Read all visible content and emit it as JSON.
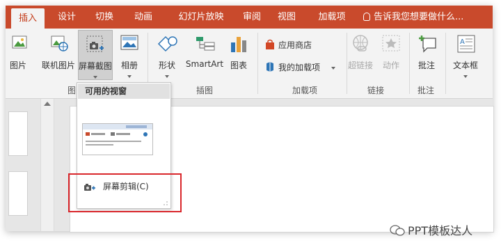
{
  "tabs": [
    {
      "label": "插入",
      "active": true
    },
    {
      "label": "设计"
    },
    {
      "label": "切换"
    },
    {
      "label": "动画"
    },
    {
      "label": "幻灯片放映"
    },
    {
      "label": "审阅"
    },
    {
      "label": "视图"
    },
    {
      "label": "加载项"
    }
  ],
  "tell_me": "告诉我您想要做什么...",
  "ribbon": {
    "pictures": "图片",
    "online_pictures": "联机图片",
    "screenshot": "屏幕截图",
    "album": "相册",
    "shapes": "形状",
    "smartart": "SmartArt",
    "chart": "图表",
    "store": "应用商店",
    "my_addins": "我的加载项",
    "hyperlink": "超链接",
    "action": "动作",
    "comment": "批注",
    "textbox": "文本框"
  },
  "groups": {
    "images_partial": "图",
    "illustrations": "插图",
    "addins": "加载项",
    "links": "链接",
    "comments": "批注"
  },
  "dropdown": {
    "header": "可用的视窗",
    "screen_clipping": "屏幕剪辑(C)"
  },
  "watermark": "PPT模板达人",
  "colors": {
    "accent": "#c94a2c",
    "highlight_box": "#d9262b"
  }
}
